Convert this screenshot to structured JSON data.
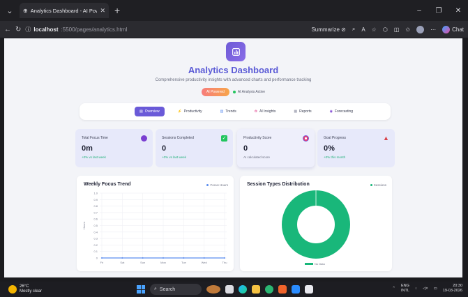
{
  "browser": {
    "tab_title": "Analytics Dashboard - AI Powered",
    "url_host": "localhost",
    "url_path": ":5500/pages/analytics.html",
    "summarize_label": "Summarize",
    "copilot_label": "Chat"
  },
  "header": {
    "title": "Analytics Dashboard",
    "subtitle": "Comprehensive productivity insights with advanced charts and performance tracking",
    "badge_ai": "AI Powered",
    "badge_status": "AI Analysis Active"
  },
  "nav": {
    "items": [
      {
        "label": "Overview",
        "icon": "chart-icon"
      },
      {
        "label": "Productivity",
        "icon": "bolt-icon"
      },
      {
        "label": "Trends",
        "icon": "trend-icon"
      },
      {
        "label": "AI Insights",
        "icon": "brain-icon"
      },
      {
        "label": "Reports",
        "icon": "report-icon"
      },
      {
        "label": "Forecasting",
        "icon": "forecast-icon"
      }
    ]
  },
  "stats": [
    {
      "label": "Total Focus Time",
      "value": "0m",
      "sub": "+0% vs last week",
      "icon": "timer-icon",
      "icon_color": "#7a3fd1"
    },
    {
      "label": "Sessions Completed",
      "value": "0",
      "sub": "+0% vs last week",
      "icon": "check-icon",
      "icon_color": "#22c55e"
    },
    {
      "label": "Productivity Score",
      "value": "0",
      "sub": "AI calculated score",
      "icon": "target-icon",
      "icon_color": "#e0407a"
    },
    {
      "label": "Goal Progress",
      "value": "0%",
      "sub": "+0% this month",
      "icon": "mountain-icon",
      "icon_color": "#d9434a"
    }
  ],
  "chart_data": [
    {
      "type": "line",
      "title": "Weekly Focus Trend",
      "ylabel": "Hours",
      "categories": [
        "Fri",
        "Sat",
        "Sun",
        "Mon",
        "Tue",
        "Wed",
        "Thu"
      ],
      "yticks": [
        "1.0",
        "0.9",
        "0.8",
        "0.7",
        "0.6",
        "0.5",
        "0.4",
        "0.3",
        "0.2",
        "0.1",
        "0"
      ],
      "ylim": [
        0,
        1
      ],
      "series": [
        {
          "name": "Focus Hours",
          "values": [
            0,
            0,
            0,
            0,
            0,
            0,
            0
          ],
          "color": "#5b8def"
        }
      ],
      "legend": "top-right",
      "grid": true
    },
    {
      "type": "pie",
      "title": "Session Types Distribution",
      "legend_top": "Sessions",
      "categories": [
        "No Data"
      ],
      "values": [
        1
      ],
      "colors": [
        "#19b77a"
      ],
      "legend": "bottom"
    }
  ],
  "taskbar": {
    "temp": "26°C",
    "weather": "Mostly clear",
    "search": "Search",
    "lang": "ENG",
    "lang2": "INTL",
    "time": "20:30",
    "date": "19-03-2026"
  },
  "colors": {
    "accent": "#5b5bd6",
    "nav_active": "#6a5ad8",
    "donut": "#19b77a"
  }
}
